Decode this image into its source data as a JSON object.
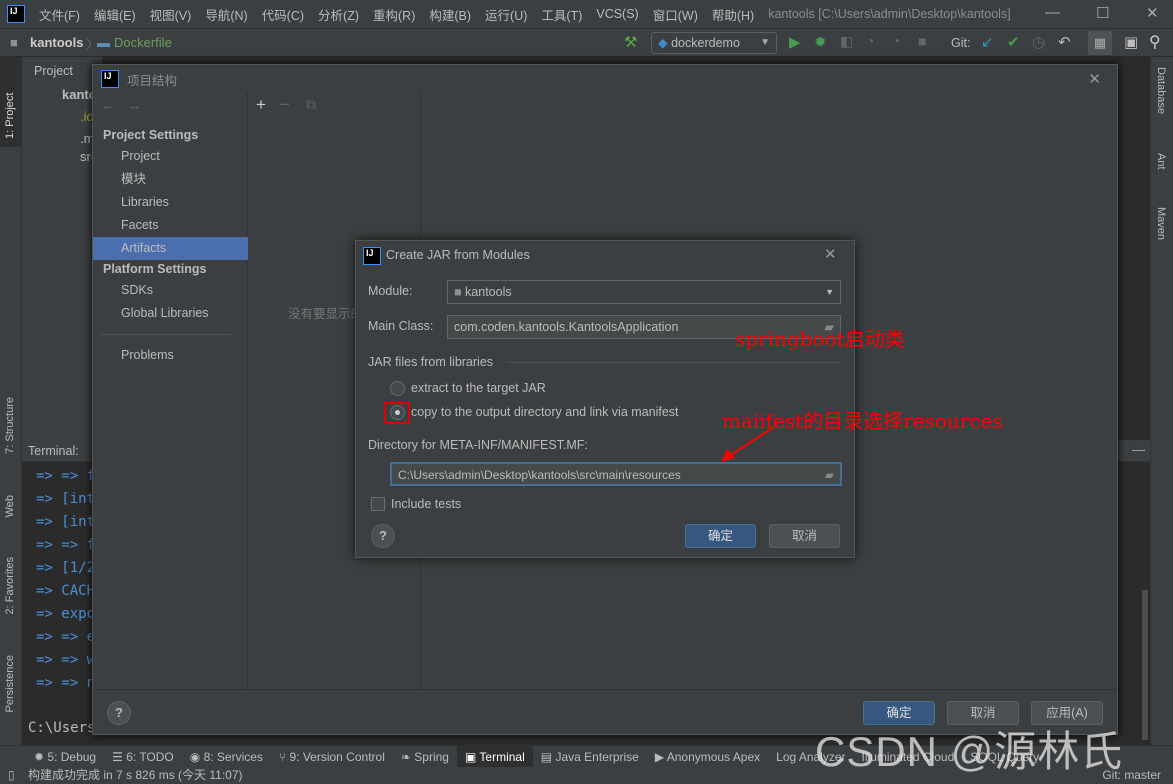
{
  "window": {
    "title": "kantools [C:\\Users\\admin\\Desktop\\kantools]"
  },
  "menu": [
    "文件(F)",
    "编辑(E)",
    "视图(V)",
    "导航(N)",
    "代码(C)",
    "分析(Z)",
    "重构(R)",
    "构建(B)",
    "运行(U)",
    "工具(T)",
    "VCS(S)",
    "窗口(W)",
    "帮助(H)"
  ],
  "breadcrumb": {
    "project": "kantools",
    "file": "Dockerfile"
  },
  "toolbar": {
    "run_config": "dockerdemo",
    "git_label": "Git:"
  },
  "left_stripe": {
    "project": "1: Project",
    "structure": "7: Structure",
    "web": "Web",
    "favorites": "2: Favorites",
    "persistence": "Persistence"
  },
  "right_stripe": {
    "database": "Database",
    "ant": "Ant",
    "maven": "Maven"
  },
  "project_panel": {
    "title": "Project",
    "root": "kantools",
    "items": [
      ".idea",
      ".mvn",
      "src"
    ]
  },
  "terminal": {
    "title": "Terminal:",
    "lines": [
      "=> => f",
      "=> [int",
      "=> [int",
      "=> => f",
      "=> [1/2",
      "=> CACH",
      "=> expo",
      "=> => e",
      "=> => w",
      "=> => n"
    ],
    "prompt": "C:\\Users"
  },
  "project_structure": {
    "title": "项目结构",
    "project_settings_header": "Project Settings",
    "project_settings": [
      "Project",
      "模块",
      "Libraries",
      "Facets",
      "Artifacts"
    ],
    "selected": "Artifacts",
    "platform_settings_header": "Platform Settings",
    "platform_settings": [
      "SDKs",
      "Global Libraries"
    ],
    "problems": "Problems",
    "empty_text": "没有要显示的",
    "ok": "确定",
    "cancel": "取消",
    "apply": "应用(A)",
    "help": "?"
  },
  "jar_dialog": {
    "title": "Create JAR from Modules",
    "module_label": "Module:",
    "module_value": "kantools",
    "main_class_label": "Main Class:",
    "main_class_value": "com.coden.kantools.KantoolsApplication",
    "libraries_header": "JAR files from libraries",
    "option_extract": "extract to the target JAR",
    "option_copy": "copy to the output directory and link via manifest",
    "selected_option": "copy",
    "manifest_label": "Directory for META-INF/MANIFEST.MF:",
    "manifest_value": "C:\\Users\\admin\\Desktop\\kantools\\src\\main\\resources",
    "include_tests": "Include tests",
    "include_tests_checked": false,
    "ok": "确定",
    "cancel": "取消",
    "help": "?"
  },
  "annotations": {
    "main_class_note": "springboot启动类",
    "manifest_note": "maiifest的目录选择resources",
    "color": "#ff0000"
  },
  "bottom_tabs": [
    "5: Debug",
    "6: TODO",
    "8: Services",
    "9: Version Control",
    "Spring",
    "Terminal",
    "Java Enterprise",
    "Anonymous Apex",
    "Log Analyzer",
    "Illuminated Cloud",
    "SOQL Query"
  ],
  "active_bottom_tab": "Terminal",
  "status": {
    "message": "构建成功完成 in 7 s 826 ms (今天 11:07)",
    "git_branch": "Git: master"
  },
  "watermark": "CSDN @源林氏"
}
